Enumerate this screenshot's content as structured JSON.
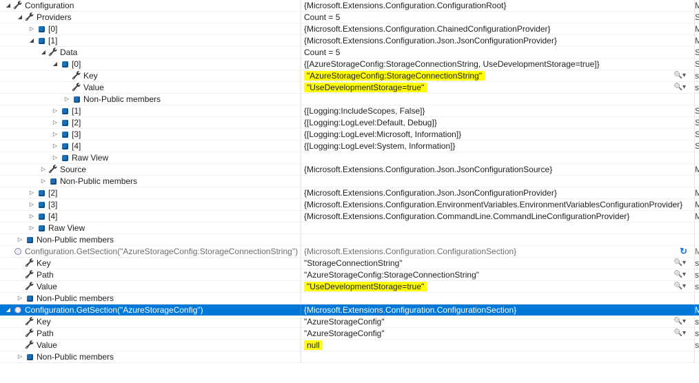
{
  "rows": [
    {
      "depth": 0,
      "exp": "open",
      "icon": "wrench",
      "name": "Configuration",
      "value": "{Microsoft.Extensions.Configuration.ConfigurationRoot}",
      "type": "M"
    },
    {
      "depth": 1,
      "exp": "open",
      "icon": "wrench",
      "name": "Providers",
      "value": "Count = 5",
      "type": "S"
    },
    {
      "depth": 2,
      "exp": "closed",
      "icon": "cube",
      "name": "[0]",
      "value": "{Microsoft.Extensions.Configuration.ChainedConfigurationProvider}",
      "type": "M"
    },
    {
      "depth": 2,
      "exp": "open",
      "icon": "cube",
      "name": "[1]",
      "value": "{Microsoft.Extensions.Configuration.Json.JsonConfigurationProvider}",
      "type": "M"
    },
    {
      "depth": 3,
      "exp": "open",
      "icon": "wrench",
      "name": "Data",
      "value": "Count = 5",
      "type": "S"
    },
    {
      "depth": 4,
      "exp": "open",
      "icon": "cube",
      "name": "[0]",
      "value": "{[AzureStorageConfig:StorageConnectionString, UseDevelopmentStorage=true]}",
      "type": "S"
    },
    {
      "depth": 5,
      "exp": "none",
      "icon": "wrench",
      "name": "Key",
      "value": "\"AzureStorageConfig:StorageConnectionString\"",
      "highlight": true,
      "magnifier": true,
      "type": "s"
    },
    {
      "depth": 5,
      "exp": "none",
      "icon": "wrench",
      "name": "Value",
      "value": "\"UseDevelopmentStorage=true\"",
      "highlight": true,
      "magnifier": true,
      "type": "s"
    },
    {
      "depth": 5,
      "exp": "closed",
      "icon": "cube",
      "name": "Non-Public members",
      "value": "",
      "type": ""
    },
    {
      "depth": 4,
      "exp": "closed",
      "icon": "cube",
      "name": "[1]",
      "value": "{[Logging:IncludeScopes, False]}",
      "type": "S"
    },
    {
      "depth": 4,
      "exp": "closed",
      "icon": "cube",
      "name": "[2]",
      "value": "{[Logging:LogLevel:Default, Debug]}",
      "type": "S"
    },
    {
      "depth": 4,
      "exp": "closed",
      "icon": "cube",
      "name": "[3]",
      "value": "{[Logging:LogLevel:Microsoft, Information]}",
      "type": "S"
    },
    {
      "depth": 4,
      "exp": "closed",
      "icon": "cube",
      "name": "[4]",
      "value": "{[Logging:LogLevel:System, Information]}",
      "type": "S"
    },
    {
      "depth": 4,
      "exp": "closed",
      "icon": "cube",
      "name": "Raw View",
      "value": "",
      "type": ""
    },
    {
      "depth": 3,
      "exp": "closed",
      "icon": "wrench",
      "name": "Source",
      "value": "{Microsoft.Extensions.Configuration.Json.JsonConfigurationSource}",
      "type": "M"
    },
    {
      "depth": 3,
      "exp": "closed",
      "icon": "cube",
      "name": "Non-Public members",
      "value": "",
      "type": ""
    },
    {
      "depth": 2,
      "exp": "closed",
      "icon": "cube",
      "name": "[2]",
      "value": "{Microsoft.Extensions.Configuration.Json.JsonConfigurationProvider}",
      "type": "M"
    },
    {
      "depth": 2,
      "exp": "closed",
      "icon": "cube",
      "name": "[3]",
      "value": "{Microsoft.Extensions.Configuration.EnvironmentVariables.EnvironmentVariablesConfigurationProvider}",
      "type": "M"
    },
    {
      "depth": 2,
      "exp": "closed",
      "icon": "cube",
      "name": "[4]",
      "value": "{Microsoft.Extensions.Configuration.CommandLine.CommandLineConfigurationProvider}",
      "type": "M"
    },
    {
      "depth": 2,
      "exp": "closed",
      "icon": "cube",
      "name": "Raw View",
      "value": "",
      "type": ""
    },
    {
      "depth": 1,
      "exp": "closed",
      "icon": "cube",
      "name": "Non-Public members",
      "value": "",
      "type": ""
    },
    {
      "depth": 0,
      "exp": "none",
      "icon": "watch",
      "name": "Configuration.GetSection(\"AzureStorageConfig:StorageConnectionString\")",
      "value": "{Microsoft.Extensions.Configuration.ConfigurationSection}",
      "refresh": true,
      "watchrow": true,
      "type": "M"
    },
    {
      "depth": 1,
      "exp": "none",
      "icon": "wrench",
      "name": "Key",
      "value": "\"StorageConnectionString\"",
      "magnifier": true,
      "type": "s"
    },
    {
      "depth": 1,
      "exp": "none",
      "icon": "wrench",
      "name": "Path",
      "value": "\"AzureStorageConfig:StorageConnectionString\"",
      "magnifier": true,
      "type": "s"
    },
    {
      "depth": 1,
      "exp": "none",
      "icon": "wrench",
      "name": "Value",
      "value": "\"UseDevelopmentStorage=true\"",
      "highlight": true,
      "magnifier": true,
      "type": "s"
    },
    {
      "depth": 1,
      "exp": "closed",
      "icon": "cube",
      "name": "Non-Public members",
      "value": "",
      "type": ""
    },
    {
      "depth": 0,
      "exp": "open",
      "icon": "watch",
      "name": "Configuration.GetSection(\"AzureStorageConfig\")",
      "value": "{Microsoft.Extensions.Configuration.ConfigurationSection}",
      "selected": true,
      "type": "M"
    },
    {
      "depth": 1,
      "exp": "none",
      "icon": "wrench",
      "name": "Key",
      "value": "\"AzureStorageConfig\"",
      "magnifier": true,
      "type": "s"
    },
    {
      "depth": 1,
      "exp": "none",
      "icon": "wrench",
      "name": "Path",
      "value": "\"AzureStorageConfig\"",
      "magnifier": true,
      "type": "s"
    },
    {
      "depth": 1,
      "exp": "none",
      "icon": "wrench",
      "name": "Value",
      "value": "null",
      "highlight": true,
      "type": "s"
    },
    {
      "depth": 1,
      "exp": "closed",
      "icon": "cube",
      "name": "Non-Public members",
      "value": "",
      "type": ""
    }
  ],
  "glyphs": {
    "open": "◢",
    "closed": "▷",
    "wrench": "🔧",
    "magnifier": "🔍 ▾",
    "refresh": "↻"
  },
  "colors": {
    "selection": "#0078d7",
    "highlight": "#ffff00",
    "icon_blue": "#1c6fb7"
  }
}
